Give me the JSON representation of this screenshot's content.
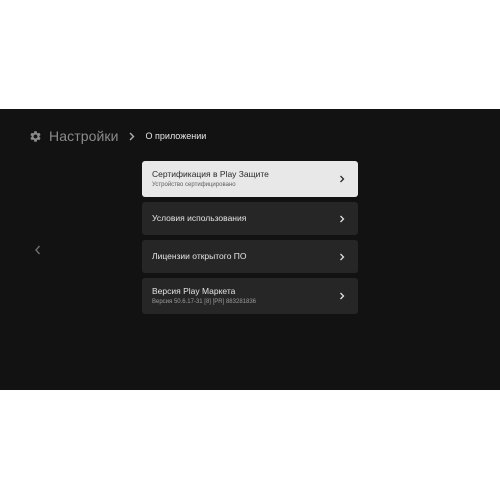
{
  "header": {
    "icon": "gear-icon",
    "title": "Настройки",
    "separator_icon": "chevron-right-icon",
    "current": "О приложении"
  },
  "nav": {
    "back_icon": "chevron-left-icon"
  },
  "menu": {
    "items": [
      {
        "title": "Сертификация в Play Защите",
        "subtitle": "Устройство сертифицировано",
        "selected": true
      },
      {
        "title": "Условия использования",
        "subtitle": "",
        "selected": false
      },
      {
        "title": "Лицензии открытого ПО",
        "subtitle": "",
        "selected": false
      },
      {
        "title": "Версия Play Маркета",
        "subtitle": "Версия 50.6.17-31 [8] [PR] 883281836",
        "selected": false
      }
    ]
  },
  "colors": {
    "screen_bg": "#121212",
    "item_bg": "#262626",
    "selected_bg": "#e8e8e8"
  }
}
